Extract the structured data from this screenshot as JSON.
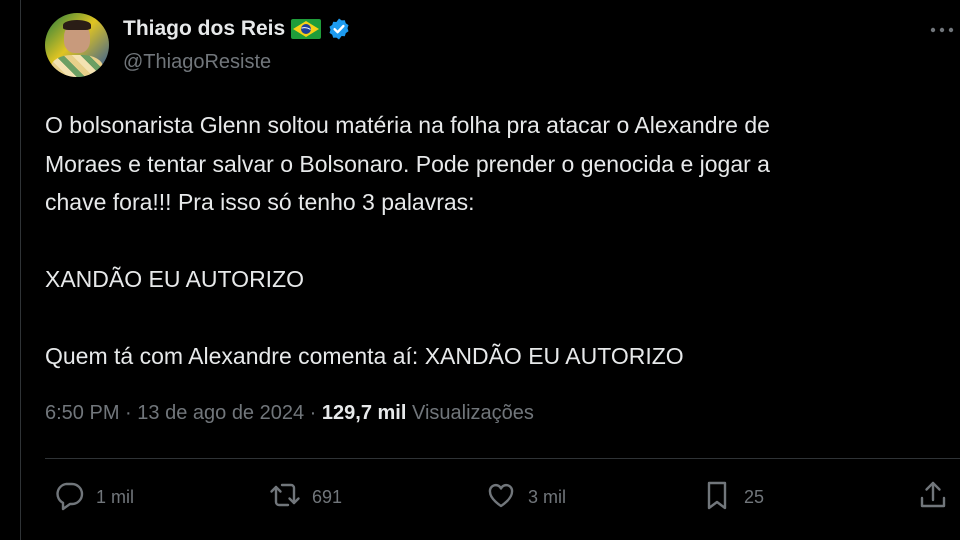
{
  "author": {
    "name": "Thiago dos Reis",
    "handle": "@ThiagoResiste"
  },
  "icons": {
    "flag": "brazil-flag-icon",
    "verified": "verified-badge-icon",
    "more": "more-options-icon",
    "reply": "reply-icon",
    "retweet": "retweet-icon",
    "like": "like-icon",
    "bookmark": "bookmark-icon",
    "share": "share-icon"
  },
  "colors": {
    "background": "#000000",
    "text": "#e7e9ea",
    "muted": "#71767b",
    "verified": "#1d9bf0",
    "divider": "#2f3336"
  },
  "post": {
    "text": "O bolsonarista Glenn soltou matéria na folha pra atacar o Alexandre de\nMoraes e tentar salvar o Bolsonaro. Pode prender o genocida e jogar a\nchave fora!!! Pra isso só tenho 3 palavras:\n\nXANDÃO EU AUTORIZO\n\nQuem tá com Alexandre comenta aí: XANDÃO EU AUTORIZO",
    "time": "6:50 PM",
    "date": "13 de ago de 2024",
    "separator": "·",
    "views_count": "129,7 mil",
    "views_label": "Visualizações"
  },
  "actions": {
    "replies": "1 mil",
    "reposts": "691",
    "likes": "3 mil",
    "bookmarks": "25"
  }
}
